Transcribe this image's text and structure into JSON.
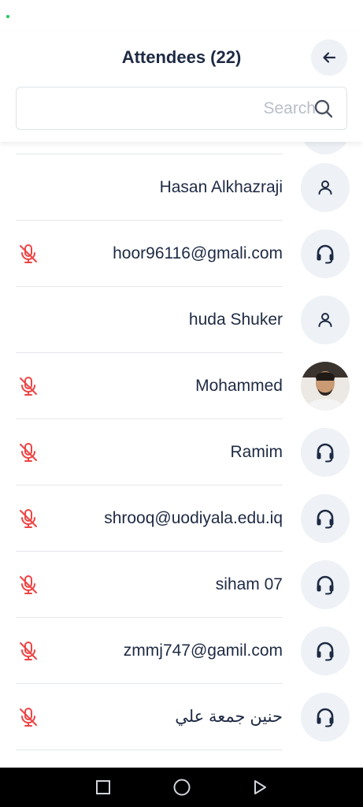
{
  "header": {
    "title": "Attendees (22)"
  },
  "search": {
    "placeholder": "Search"
  },
  "attendees": [
    {
      "name": "Hasan Alkhazraji",
      "avatar": "person-icon",
      "muted": false
    },
    {
      "name": "hoor96116@gmali.com",
      "avatar": "headset-icon",
      "muted": true
    },
    {
      "name": "huda Shuker",
      "avatar": "person-icon",
      "muted": false
    },
    {
      "name": "Mohammed",
      "avatar": "photo",
      "muted": true
    },
    {
      "name": "Ramim",
      "avatar": "headset-icon",
      "muted": true
    },
    {
      "name": "shrooq@uodiyala.edu.iq",
      "avatar": "headset-icon",
      "muted": true
    },
    {
      "name": "siham 07",
      "avatar": "headset-icon",
      "muted": true
    },
    {
      "name": "zmmj747@gamil.com",
      "avatar": "headset-icon",
      "muted": true
    },
    {
      "name": "حنين جمعة علي",
      "avatar": "headset-icon",
      "muted": true
    }
  ],
  "colors": {
    "accent": "#1e2a44",
    "muted_mic": "#ef4444",
    "avatar_bg": "#eef1f5",
    "divider": "#e5e7eb"
  }
}
